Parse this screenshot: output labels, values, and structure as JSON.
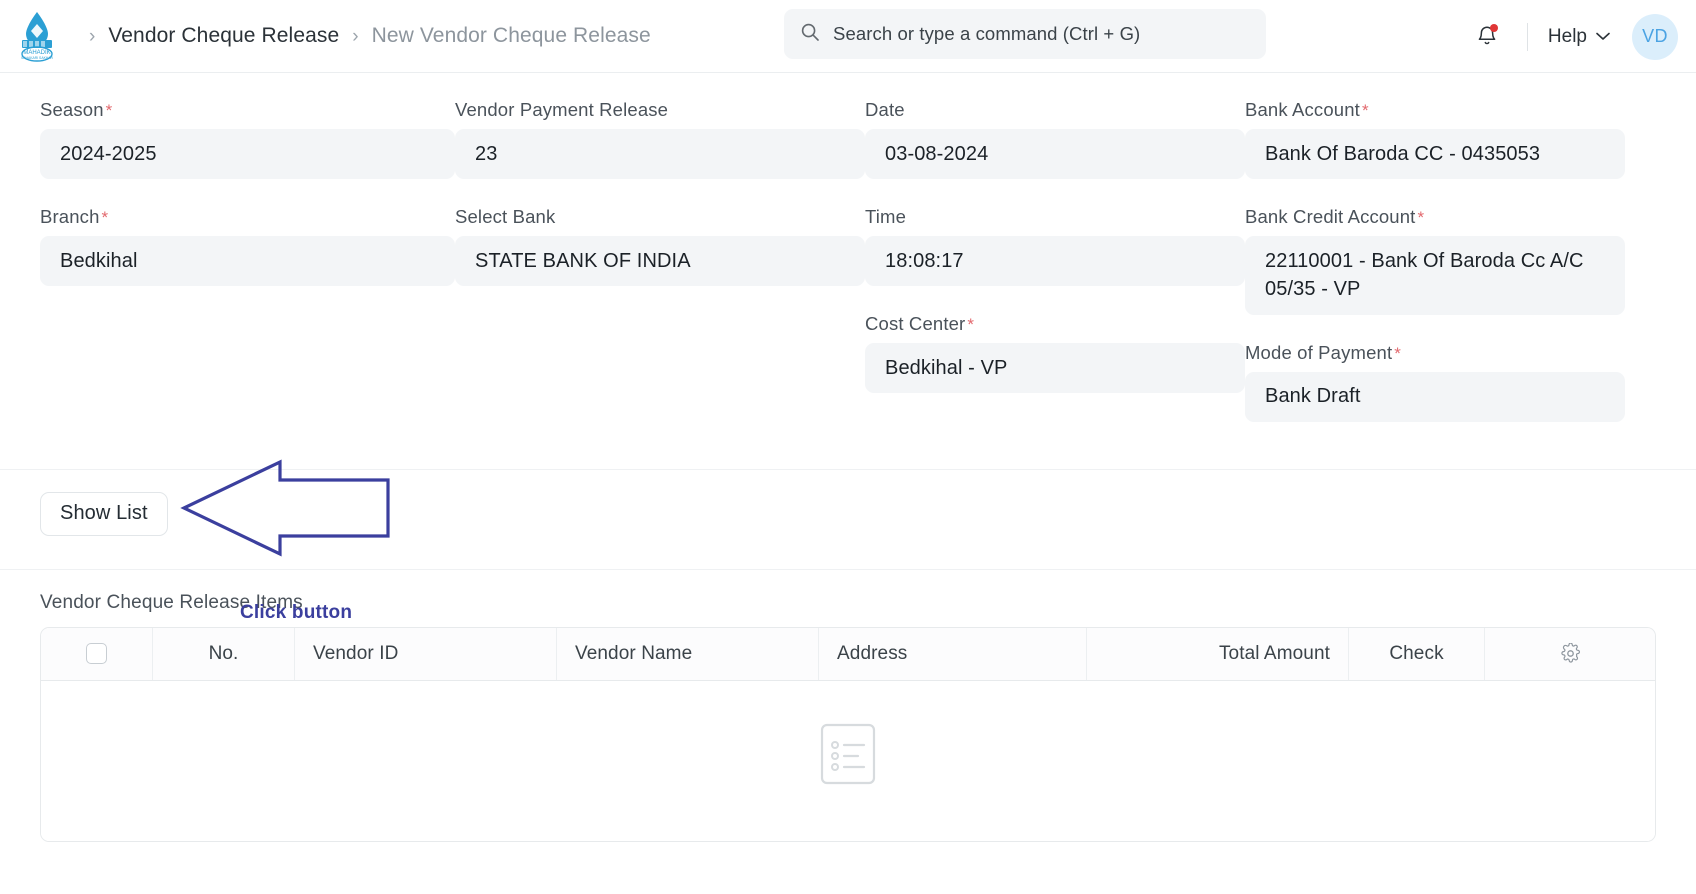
{
  "navbar": {
    "logo_alt": "Mahadik logo",
    "logo_text": "MAHADIK",
    "breadcrumb": {
      "separator": "›",
      "parent": "Vendor Cheque Release",
      "current": "New Vendor Cheque Release"
    },
    "search": {
      "placeholder": "Search or type a command (Ctrl + G)",
      "value": ""
    },
    "notification_icon": "bell-icon",
    "has_notification": true,
    "help_label": "Help",
    "avatar_initials": "VD"
  },
  "form": {
    "columns": [
      {
        "fields": [
          {
            "label": "Season",
            "required": true,
            "value": "2024-2025"
          },
          {
            "label": "Branch",
            "required": true,
            "value": "Bedkihal"
          }
        ]
      },
      {
        "fields": [
          {
            "label": "Vendor Payment Release",
            "required": false,
            "value": "23"
          },
          {
            "label": "Select Bank",
            "required": false,
            "value": "STATE BANK OF INDIA"
          }
        ]
      },
      {
        "fields": [
          {
            "label": "Date",
            "required": false,
            "value": "03-08-2024"
          },
          {
            "label": "Time",
            "required": false,
            "value": "18:08:17"
          },
          {
            "label": "Cost Center",
            "required": true,
            "value": "Bedkihal - VP"
          }
        ]
      },
      {
        "fields": [
          {
            "label": "Bank Account",
            "required": true,
            "value": "Bank Of Baroda CC -  0435053"
          },
          {
            "label": "Bank Credit Account",
            "required": true,
            "value": "22110001 - Bank Of Baroda Cc A/C 05/35 - VP"
          },
          {
            "label": "Mode of Payment",
            "required": true,
            "value": "Bank Draft"
          }
        ]
      }
    ]
  },
  "actions": {
    "show_list_label": "Show List"
  },
  "annotation": {
    "text": "Click button",
    "color": "#3b3f9e",
    "shape": "left-arrow-callout"
  },
  "grid": {
    "title": "Vendor Cheque Release Items",
    "columns": [
      {
        "key": "select",
        "label": ""
      },
      {
        "key": "no",
        "label": "No."
      },
      {
        "key": "vendor_id",
        "label": "Vendor ID"
      },
      {
        "key": "vendor_name",
        "label": "Vendor Name"
      },
      {
        "key": "address",
        "label": "Address"
      },
      {
        "key": "total_amount",
        "label": "Total Amount"
      },
      {
        "key": "check",
        "label": "Check"
      },
      {
        "key": "settings",
        "label": ""
      }
    ],
    "rows": [],
    "empty_icon": "empty-list-icon",
    "settings_icon": "gear-icon"
  }
}
